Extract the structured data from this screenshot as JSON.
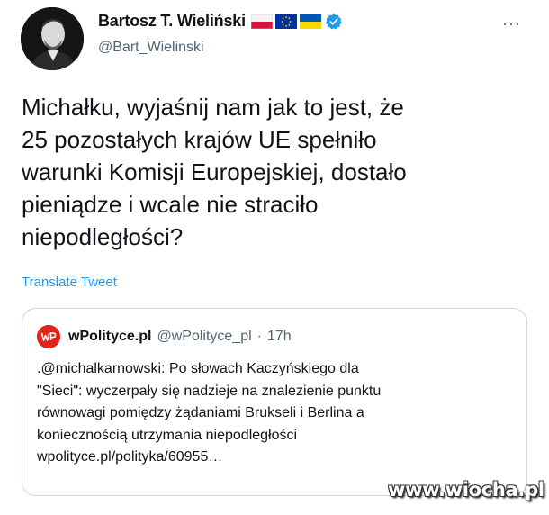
{
  "author": {
    "display_name": "Bartosz T. Wieliński",
    "handle": "@Bart_Wielinski",
    "flags": [
      "poland-flag-icon",
      "eu-flag-icon",
      "ukraine-flag-icon"
    ],
    "verified": true
  },
  "more_label": "···",
  "tweet": {
    "lines": [
      "Michałku, wyjaśnij nam jak to jest, że",
      "25 pozostałych krajów UE spełniło",
      "warunki Komisji Europejskiej, dostało",
      "pieniądze i wcale nie straciło",
      "niepodległości?"
    ],
    "translate_label": "Translate Tweet"
  },
  "quoted": {
    "name": "wPolityce.pl",
    "handle": "@wPolityce_pl",
    "separator": "·",
    "time": "17h",
    "lines": [
      ".@michalkarnowski: Po słowach Kaczyńskiego dla",
      "\"Sieci\": wyczerpały się nadzieje na znalezienie punktu",
      "równowagi pomiędzy żądaniami Brukseli i Berlina a",
      "koniecznością utrzymania niepodległości",
      "wpolityce.pl/polityka/60955…"
    ]
  },
  "watermark": "www.wiocha.pl",
  "colors": {
    "text": "#0f1419",
    "secondary": "#536471",
    "link": "#1d9bf0",
    "border": "#cfd9de",
    "wpolityce_red": "#e2231a"
  }
}
